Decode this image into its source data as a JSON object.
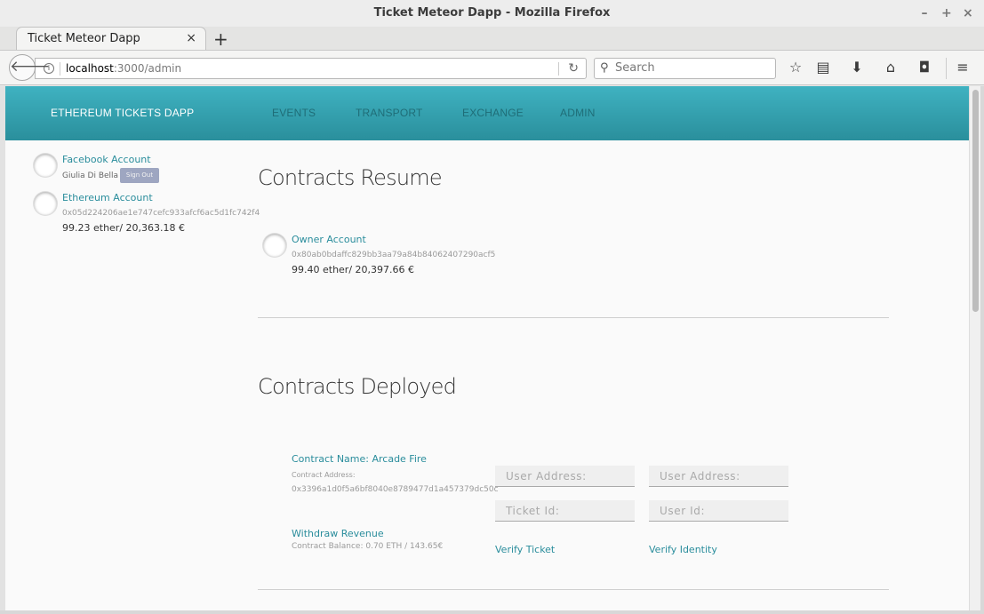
{
  "window": {
    "title": "Ticket Meteor Dapp - Mozilla Firefox",
    "controls": [
      "–",
      "+",
      "×"
    ]
  },
  "browser": {
    "tab_title": "Ticket Meteor Dapp",
    "tab_close": "×",
    "new_tab": "+",
    "url_host": "localhost",
    "url_path": ":3000/admin",
    "search_placeholder": "Search"
  },
  "app": {
    "brand": "ETHEREUM TICKETS DAPP",
    "nav": [
      "EVENTS",
      "TRANSPORT",
      "EXCHANGE",
      "ADMIN"
    ]
  },
  "sidebar": {
    "facebook_label": "Facebook Account",
    "user_name": "Giulia Di Bella",
    "signout_label": "Sign Out",
    "ethereum_label": "Ethereum Account",
    "ethereum_address": "0x05d224206ae1e747cefc933afcf6ac5d1fc742f4",
    "ethereum_balance": "99.23 ether/ 20,363.18 €"
  },
  "resume": {
    "title": "Contracts Resume",
    "owner_label": "Owner Account",
    "owner_address": "0x80ab0bdaffc829bb3aa79a84b84062407290acf5",
    "owner_balance": "99.40 ether/ 20,397.66 €"
  },
  "deployed": {
    "title": "Contracts Deployed",
    "contract_name": "Contract Name: Arcade Fire",
    "contract_address_label": "Contract Address:",
    "contract_address": "0x3396a1d0f5a6bf8040e8789477d1a457379dc50c",
    "withdraw_label": "Withdraw Revenue",
    "contract_balance": "Contract Balance: 0.70 ETH / 143.65€",
    "user_address_placeholder": "User Address:",
    "ticket_id_placeholder": "Ticket Id:",
    "user_id_placeholder": "User Id:",
    "verify_ticket_label": "Verify Ticket",
    "verify_identity_label": "Verify Identity"
  }
}
